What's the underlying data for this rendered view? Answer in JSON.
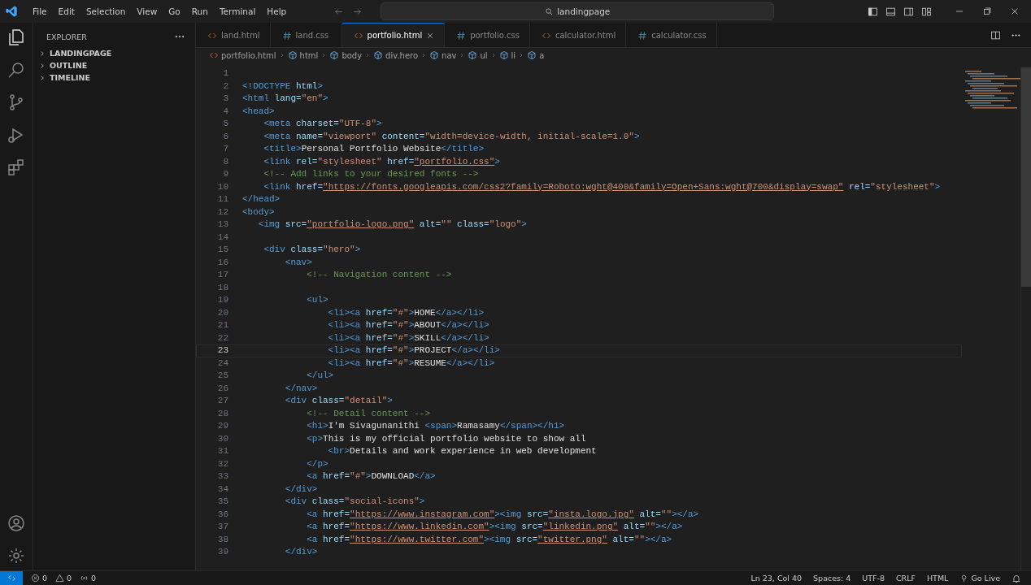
{
  "title_bar": {
    "menu": [
      "File",
      "Edit",
      "Selection",
      "View",
      "Go",
      "Run",
      "Terminal",
      "Help"
    ],
    "search": {
      "value": "landingpage"
    }
  },
  "activity_bar": {
    "items": [
      {
        "kind": "explorer",
        "selected": true
      },
      {
        "kind": "search",
        "selected": false
      },
      {
        "kind": "source-control",
        "selected": false
      },
      {
        "kind": "run",
        "selected": false
      },
      {
        "kind": "extensions",
        "selected": false
      }
    ],
    "bottom": [
      {
        "kind": "account"
      },
      {
        "kind": "settings"
      }
    ]
  },
  "sidebar": {
    "title": "EXPLORER",
    "sections": [
      {
        "label": "LANDINGPAGE",
        "expanded": false
      },
      {
        "label": "OUTLINE",
        "expanded": false
      },
      {
        "label": "TIMELINE",
        "expanded": false
      }
    ]
  },
  "tabs": [
    {
      "label": "land.html",
      "kind": "html",
      "selected": false
    },
    {
      "label": "land.css",
      "kind": "css",
      "selected": false
    },
    {
      "label": "portfolio.html",
      "kind": "html",
      "selected": true
    },
    {
      "label": "portfolio.css",
      "kind": "css",
      "selected": false
    },
    {
      "label": "calculator.html",
      "kind": "html",
      "selected": false
    },
    {
      "label": "calculator.css",
      "kind": "css",
      "selected": false
    }
  ],
  "breadcrumbs": [
    {
      "label": "portfolio.html",
      "kind": "file"
    },
    {
      "label": "html",
      "kind": "element"
    },
    {
      "label": "body",
      "kind": "element"
    },
    {
      "label": "div.hero",
      "kind": "element"
    },
    {
      "label": "nav",
      "kind": "element"
    },
    {
      "label": "ul",
      "kind": "element"
    },
    {
      "label": "li",
      "kind": "element"
    },
    {
      "label": "a",
      "kind": "element"
    }
  ],
  "editor": {
    "lines": [
      {
        "number": "1",
        "selected": false
      },
      {
        "number": "2",
        "selected": false,
        "segments": [
          {
            "kind": "tag",
            "text": "<!DOCTYPE"
          },
          {
            "kind": "attr",
            "text": " html"
          },
          {
            "kind": "tag",
            "text": ">"
          }
        ]
      },
      {
        "number": "3",
        "selected": false,
        "segments": [
          {
            "kind": "tag",
            "text": "<html"
          },
          {
            "kind": "attr",
            "text": " lang="
          },
          {
            "kind": "string",
            "text": "\"en\""
          },
          {
            "kind": "tag",
            "text": ">"
          }
        ]
      },
      {
        "number": "4",
        "selected": false,
        "segments": [
          {
            "kind": "tag",
            "text": "<head>"
          }
        ]
      },
      {
        "number": "5",
        "selected": false,
        "segments": [
          {
            "kind": "tag",
            "text": "    <meta"
          },
          {
            "kind": "attr",
            "text": " charset="
          },
          {
            "kind": "string",
            "text": "\"UTF-8\""
          },
          {
            "kind": "tag",
            "text": ">"
          }
        ]
      },
      {
        "number": "6",
        "selected": false,
        "segments": [
          {
            "kind": "tag",
            "text": "    <meta"
          },
          {
            "kind": "attr",
            "text": " name="
          },
          {
            "kind": "string",
            "text": "\"viewport\""
          },
          {
            "kind": "attr",
            "text": " content="
          },
          {
            "kind": "string",
            "text": "\"width=device-width, initial-scale=1.0\""
          },
          {
            "kind": "tag",
            "text": ">"
          }
        ]
      },
      {
        "number": "7",
        "selected": false,
        "segments": [
          {
            "kind": "tag",
            "text": "    <title>"
          },
          {
            "kind": "text",
            "text": "Personal Portfolio Website"
          },
          {
            "kind": "tag",
            "text": "</title>"
          }
        ]
      },
      {
        "number": "8",
        "selected": false,
        "segments": [
          {
            "kind": "tag",
            "text": "    <link"
          },
          {
            "kind": "attr",
            "text": " rel="
          },
          {
            "kind": "string",
            "text": "\"stylesheet\""
          },
          {
            "kind": "attr",
            "text": " href="
          },
          {
            "kind": "link",
            "text": "\"portfolio.css\""
          },
          {
            "kind": "tag",
            "text": ">"
          }
        ]
      },
      {
        "number": "9",
        "selected": false,
        "segments": [
          {
            "kind": "comment",
            "text": "    <!-- Add links to your desired fonts -->"
          }
        ]
      },
      {
        "number": "10",
        "selected": false,
        "segments": [
          {
            "kind": "tag",
            "text": "    <link"
          },
          {
            "kind": "attr",
            "text": " href="
          },
          {
            "kind": "link",
            "text": "\"https://fonts.googleapis.com/css2?family=Roboto:wght@400&family=Open+Sans:wght@700&display=swap\""
          },
          {
            "kind": "attr",
            "text": " rel="
          },
          {
            "kind": "string",
            "text": "\"stylesheet\""
          },
          {
            "kind": "tag",
            "text": ">"
          }
        ]
      },
      {
        "number": "11",
        "selected": false,
        "segments": [
          {
            "kind": "tag",
            "text": "</head>"
          }
        ]
      },
      {
        "number": "12",
        "selected": false,
        "segments": [
          {
            "kind": "tag",
            "text": "<body>"
          }
        ]
      },
      {
        "number": "13",
        "selected": false,
        "segments": [
          {
            "kind": "tag",
            "text": "   <img"
          },
          {
            "kind": "attr",
            "text": " src="
          },
          {
            "kind": "link",
            "text": "\"portfolio-logo.png\""
          },
          {
            "kind": "attr",
            "text": " alt="
          },
          {
            "kind": "string",
            "text": "\"\""
          },
          {
            "kind": "attr",
            "text": " class="
          },
          {
            "kind": "string",
            "text": "\"logo\""
          },
          {
            "kind": "tag",
            "text": ">"
          }
        ]
      },
      {
        "number": "14",
        "selected": false
      },
      {
        "number": "15",
        "selected": false,
        "segments": [
          {
            "kind": "tag",
            "text": "    <div"
          },
          {
            "kind": "attr",
            "text": " class="
          },
          {
            "kind": "string",
            "text": "\"hero\""
          },
          {
            "kind": "tag",
            "text": ">"
          }
        ]
      },
      {
        "number": "16",
        "selected": false,
        "segments": [
          {
            "kind": "tag",
            "text": "        <nav>"
          }
        ]
      },
      {
        "number": "17",
        "selected": false,
        "segments": [
          {
            "kind": "comment",
            "text": "            <!-- Navigation content -->"
          }
        ]
      },
      {
        "number": "18",
        "selected": false
      },
      {
        "number": "19",
        "selected": false,
        "segments": [
          {
            "kind": "tag",
            "text": "            <ul>"
          }
        ]
      },
      {
        "number": "20",
        "selected": false,
        "segments": [
          {
            "kind": "tag",
            "text": "                <li><a"
          },
          {
            "kind": "attr",
            "text": " href="
          },
          {
            "kind": "string",
            "text": "\"#\""
          },
          {
            "kind": "tag",
            "text": ">"
          },
          {
            "kind": "text",
            "text": "HOME"
          },
          {
            "kind": "tag",
            "text": "</a></li>"
          }
        ]
      },
      {
        "number": "21",
        "selected": false,
        "segments": [
          {
            "kind": "tag",
            "text": "                <li><a"
          },
          {
            "kind": "attr",
            "text": " href="
          },
          {
            "kind": "string",
            "text": "\"#\""
          },
          {
            "kind": "tag",
            "text": ">"
          },
          {
            "kind": "text",
            "text": "ABOUT"
          },
          {
            "kind": "tag",
            "text": "</a></li>"
          }
        ]
      },
      {
        "number": "22",
        "selected": false,
        "segments": [
          {
            "kind": "tag",
            "text": "                <li><a"
          },
          {
            "kind": "attr",
            "text": " href="
          },
          {
            "kind": "string",
            "text": "\"#\""
          },
          {
            "kind": "tag",
            "text": ">"
          },
          {
            "kind": "text",
            "text": "SKILL"
          },
          {
            "kind": "tag",
            "text": "</a></li>"
          }
        ]
      },
      {
        "number": "23",
        "selected": true,
        "segments": [
          {
            "kind": "tag",
            "text": "                <li><a"
          },
          {
            "kind": "attr",
            "text": " href="
          },
          {
            "kind": "string",
            "text": "\"#\""
          },
          {
            "kind": "tag",
            "text": ">"
          },
          {
            "kind": "text",
            "text": "PROJECT"
          },
          {
            "kind": "tag",
            "text": "</a></li>"
          }
        ]
      },
      {
        "number": "24",
        "selected": false,
        "segments": [
          {
            "kind": "tag",
            "text": "                <li><a"
          },
          {
            "kind": "attr",
            "text": " href="
          },
          {
            "kind": "string",
            "text": "\"#\""
          },
          {
            "kind": "tag",
            "text": ">"
          },
          {
            "kind": "text",
            "text": "RESUME"
          },
          {
            "kind": "tag",
            "text": "</a></li>"
          }
        ]
      },
      {
        "number": "25",
        "selected": false,
        "segments": [
          {
            "kind": "tag",
            "text": "            </ul>"
          }
        ]
      },
      {
        "number": "26",
        "selected": false,
        "segments": [
          {
            "kind": "tag",
            "text": "        </nav>"
          }
        ]
      },
      {
        "number": "27",
        "selected": false,
        "segments": [
          {
            "kind": "tag",
            "text": "        <div"
          },
          {
            "kind": "attr",
            "text": " class="
          },
          {
            "kind": "string",
            "text": "\"detail\""
          },
          {
            "kind": "tag",
            "text": ">"
          }
        ]
      },
      {
        "number": "28",
        "selected": false,
        "segments": [
          {
            "kind": "comment",
            "text": "            <!-- Detail content -->"
          }
        ]
      },
      {
        "number": "29",
        "selected": false,
        "segments": [
          {
            "kind": "tag",
            "text": "            <h1>"
          },
          {
            "kind": "text",
            "text": "I'm Sivagunanithi "
          },
          {
            "kind": "tag",
            "text": "<span>"
          },
          {
            "kind": "text",
            "text": "Ramasamy"
          },
          {
            "kind": "tag",
            "text": "</span></h1>"
          }
        ]
      },
      {
        "number": "30",
        "selected": false,
        "segments": [
          {
            "kind": "tag",
            "text": "            <p>"
          },
          {
            "kind": "text",
            "text": "This is my official portfolio website to show all"
          }
        ]
      },
      {
        "number": "31",
        "selected": false,
        "segments": [
          {
            "kind": "tag",
            "text": "                <br>"
          },
          {
            "kind": "text",
            "text": "Details and work experience in web development"
          }
        ]
      },
      {
        "number": "32",
        "selected": false,
        "segments": [
          {
            "kind": "tag",
            "text": "            </p>"
          }
        ]
      },
      {
        "number": "33",
        "selected": false,
        "segments": [
          {
            "kind": "tag",
            "text": "            <a"
          },
          {
            "kind": "attr",
            "text": " href="
          },
          {
            "kind": "string",
            "text": "\"#\""
          },
          {
            "kind": "tag",
            "text": ">"
          },
          {
            "kind": "text",
            "text": "DOWNLOAD"
          },
          {
            "kind": "tag",
            "text": "</a>"
          }
        ]
      },
      {
        "number": "34",
        "selected": false,
        "segments": [
          {
            "kind": "tag",
            "text": "        </div>"
          }
        ]
      },
      {
        "number": "35",
        "selected": false,
        "segments": [
          {
            "kind": "tag",
            "text": "        <div"
          },
          {
            "kind": "attr",
            "text": " class="
          },
          {
            "kind": "string",
            "text": "\"social-icons\""
          },
          {
            "kind": "tag",
            "text": ">"
          }
        ]
      },
      {
        "number": "36",
        "selected": false,
        "segments": [
          {
            "kind": "tag",
            "text": "            <a"
          },
          {
            "kind": "attr",
            "text": " href="
          },
          {
            "kind": "link",
            "text": "\"https://www.instagram.com\""
          },
          {
            "kind": "tag",
            "text": "><img"
          },
          {
            "kind": "attr",
            "text": " src="
          },
          {
            "kind": "link",
            "text": "\"insta.logo.jpg\""
          },
          {
            "kind": "attr",
            "text": " alt="
          },
          {
            "kind": "string",
            "text": "\"\""
          },
          {
            "kind": "tag",
            "text": "></a>"
          }
        ]
      },
      {
        "number": "37",
        "selected": false,
        "segments": [
          {
            "kind": "tag",
            "text": "            <a"
          },
          {
            "kind": "attr",
            "text": " href="
          },
          {
            "kind": "link",
            "text": "\"https://www.linkedin.com\""
          },
          {
            "kind": "tag",
            "text": "><img"
          },
          {
            "kind": "attr",
            "text": " src="
          },
          {
            "kind": "link",
            "text": "\"linkedin.png\""
          },
          {
            "kind": "attr",
            "text": " alt="
          },
          {
            "kind": "string",
            "text": "\"\""
          },
          {
            "kind": "tag",
            "text": "></a>"
          }
        ]
      },
      {
        "number": "38",
        "selected": false,
        "segments": [
          {
            "kind": "tag",
            "text": "            <a"
          },
          {
            "kind": "attr",
            "text": " href="
          },
          {
            "kind": "link",
            "text": "\"https://www.twitter.com\""
          },
          {
            "kind": "tag",
            "text": "><img"
          },
          {
            "kind": "attr",
            "text": " src="
          },
          {
            "kind": "link",
            "text": "\"twitter.png\""
          },
          {
            "kind": "attr",
            "text": " alt="
          },
          {
            "kind": "string",
            "text": "\"\""
          },
          {
            "kind": "tag",
            "text": "></a>"
          }
        ]
      },
      {
        "number": "39",
        "selected": false,
        "segments": [
          {
            "kind": "tag",
            "text": "        </div>"
          }
        ]
      }
    ]
  },
  "status_bar": {
    "left": [
      {
        "kind": "errors",
        "text": "0"
      },
      {
        "kind": "warnings",
        "text": "0"
      },
      {
        "kind": "ports",
        "text": "0"
      }
    ],
    "right": [
      {
        "kind": "text",
        "text": "Ln 23, Col 40"
      },
      {
        "kind": "text",
        "text": "Spaces: 4"
      },
      {
        "kind": "text",
        "text": "UTF-8"
      },
      {
        "kind": "text",
        "text": "CRLF"
      },
      {
        "kind": "text",
        "text": "HTML"
      },
      {
        "kind": "golive",
        "text": "Go Live"
      },
      {
        "kind": "bell"
      }
    ]
  }
}
